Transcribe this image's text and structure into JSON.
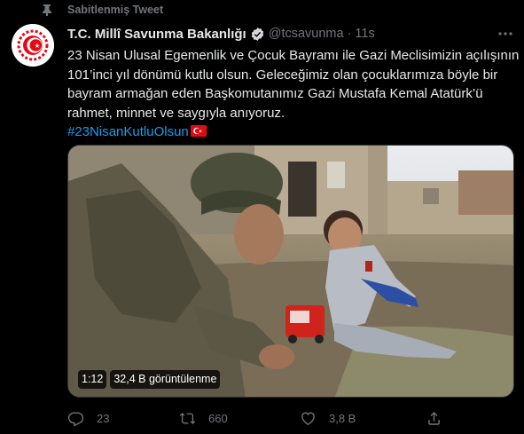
{
  "pinned": {
    "label": "Sabitlenmiş Tweet",
    "icon": "pin-icon"
  },
  "author": {
    "name": "T.C. Millî Savunma Bakanlığı",
    "handle": "@tcsavunma",
    "separator": "·",
    "time": "11s",
    "verified_icon": "verified-badge-icon",
    "avatar_icon": "ministry-emblem-icon"
  },
  "tweet": {
    "lines": [
      "23 Nisan Ulusal Egemenlik ve Çocuk Bayramı ile Gazi Meclisimizin açılışının",
      "101’inci yıl dönümü kutlu olsun. Geleceğimiz olan çocuklarımıza böyle bir",
      "bayram armağan eden Başkomutanımız Gazi Mustafa Kemal Atatürk’ü",
      "rahmet, minnet ve saygıyla anıyoruz."
    ],
    "hashtag": "#23NisanKutluOlsun",
    "hashtag_emoji": "turkey-flag-icon"
  },
  "media": {
    "duration": "1:12",
    "views": "32,4 B görüntülenme"
  },
  "actions": {
    "reply_count": "23",
    "retweet_count": "660",
    "like_count": "3,8 B",
    "share_count": ""
  },
  "colors": {
    "background": "#000000",
    "text": "#e7e9ea",
    "muted": "#71767b",
    "accent": "#1d9bf0",
    "emblem_red": "#e30a17"
  }
}
